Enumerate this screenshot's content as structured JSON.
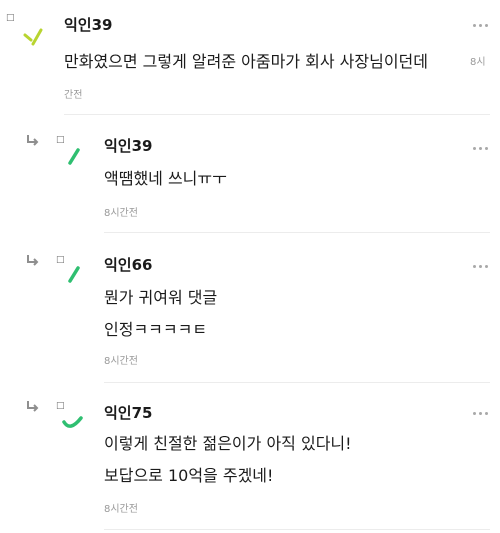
{
  "colors": {
    "avatar_green": "#2fbf71",
    "avatar_lime": "#b8d430",
    "text": "#1b1b1b",
    "meta": "#9a9a9a"
  },
  "icons": {
    "reply": "reply-arrow-icon",
    "more": "more-horizontal-icon",
    "marker": "□"
  },
  "comments": [
    {
      "author": "익인39",
      "lines": [
        "만화였으면 그렇게 알려준 아줌마가 회사 사장님이던데"
      ],
      "inline_time": "8시",
      "time": "간전",
      "is_reply": false
    },
    {
      "author": "익인39",
      "lines": [
        "액땜했네 쓰니ㅠㅜ"
      ],
      "time": "8시간전",
      "is_reply": true
    },
    {
      "author": "익인66",
      "lines": [
        "뭔가 귀여워 댓글",
        "인정ㅋㅋㅋㅋㅌ"
      ],
      "time": "8시간전",
      "is_reply": true
    },
    {
      "author": "익인75",
      "lines": [
        "이렇게 친절한 젊은이가 아직 있다니!",
        "보답으로 10억을 주겠네!"
      ],
      "time": "8시간전",
      "is_reply": true
    }
  ]
}
